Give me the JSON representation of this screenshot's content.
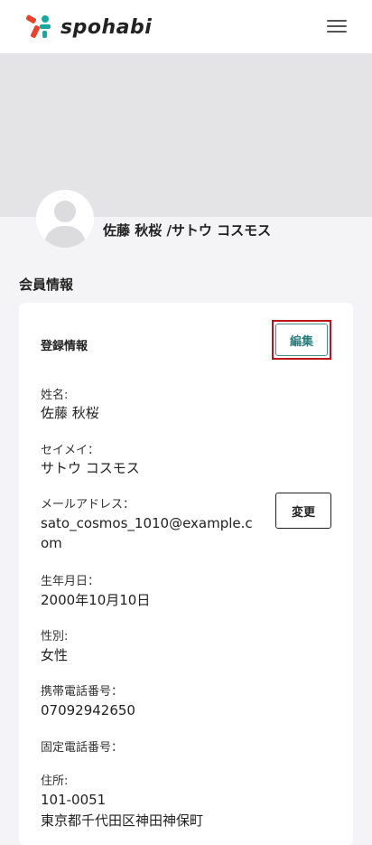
{
  "app": {
    "logo_text": "spohabi",
    "menu_icon": "hamburger-menu-icon"
  },
  "profile": {
    "name": "佐藤 秋桜 /サトウ コスモス"
  },
  "section": {
    "title": "会員情報"
  },
  "card": {
    "title": "登録情報",
    "edit_label": "編集",
    "change_label": "変更",
    "fields": {
      "name": {
        "label": "姓名:",
        "value": "佐藤 秋桜"
      },
      "kana": {
        "label": "セイメイ：",
        "value": "サトウ コスモス"
      },
      "email": {
        "label": "メールアドレス：",
        "value": "sato_cosmos_1010@example.com"
      },
      "birthday": {
        "label": "生年月日：",
        "value": "2000年10月10日"
      },
      "gender": {
        "label": "性別:",
        "value": "女性"
      },
      "mobile": {
        "label": "携帯電話番号：",
        "value": "07092942650"
      },
      "landline": {
        "label": "固定電話番号：",
        "value": ""
      },
      "address": {
        "label": "住所:",
        "postal": "101-0051",
        "value": "東京都千代田区神田神保町"
      }
    }
  },
  "colors": {
    "accent": "#2f7d7d",
    "highlight": "#c0141c",
    "logo_red": "#e8412c",
    "logo_teal": "#19a8a0"
  }
}
